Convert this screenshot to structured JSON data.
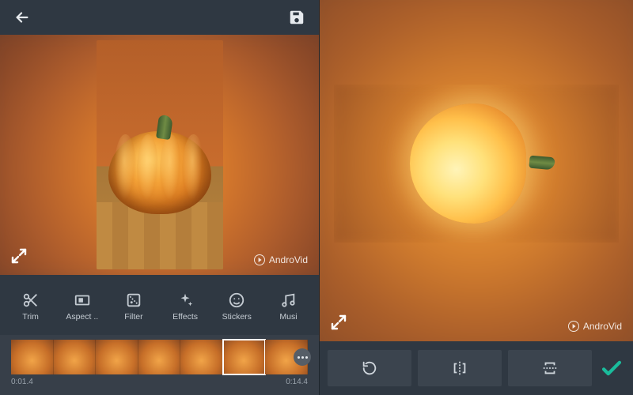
{
  "left": {
    "watermark": "AndroVid",
    "tools": [
      {
        "label": "Trim",
        "icon": "scissors-icon"
      },
      {
        "label": "Aspect ..",
        "icon": "aspect-icon"
      },
      {
        "label": "Filter",
        "icon": "filter-icon"
      },
      {
        "label": "Effects",
        "icon": "sparkle-icon"
      },
      {
        "label": "Stickers",
        "icon": "smiley-icon"
      },
      {
        "label": "Musi",
        "icon": "music-icon"
      }
    ],
    "timeline": {
      "start": "0:01.4",
      "end": "0:14.4"
    }
  },
  "right": {
    "watermark": "AndroVid"
  }
}
